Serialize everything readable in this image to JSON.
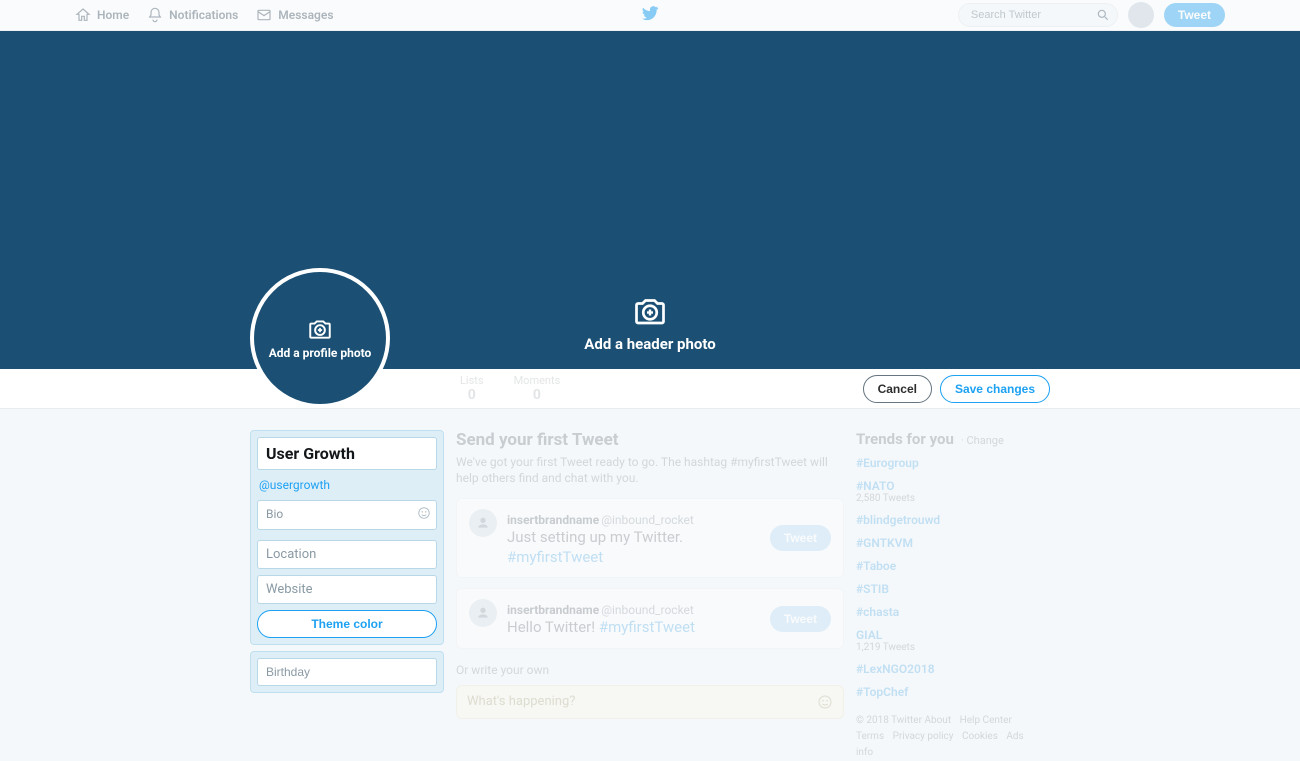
{
  "nav": {
    "home": "Home",
    "notifications": "Notifications",
    "messages": "Messages",
    "searchPlaceholder": "Search Twitter",
    "tweet": "Tweet"
  },
  "header": {
    "addHeader": "Add a header photo",
    "addProfile": "Add a profile photo"
  },
  "stats": {
    "listsLabel": "Lists",
    "listsVal": "0",
    "momentsLabel": "Moments",
    "momentsVal": "0"
  },
  "buttons": {
    "cancel": "Cancel",
    "save": "Save changes",
    "theme": "Theme color"
  },
  "edit": {
    "name": "User Growth",
    "handle": "@usergrowth",
    "bioPlaceholder": "Bio",
    "locationPlaceholder": "Location",
    "websitePlaceholder": "Website",
    "birthdayPlaceholder": "Birthday"
  },
  "first": {
    "title": "Send your first Tweet",
    "sub": "We've got your first Tweet ready to go. The hashtag #myfirstTweet will help others find and chat with you."
  },
  "tweets": [
    {
      "name": "insertbrandname",
      "handle": "@inbound_rocket",
      "textA": "Just setting up my Twitter. ",
      "hashtag": "#myfirstTweet",
      "btn": "Tweet"
    },
    {
      "name": "insertbrandname",
      "handle": "@inbound_rocket",
      "textA": "Hello Twitter! ",
      "hashtag": "#myfirstTweet",
      "btn": "Tweet"
    }
  ],
  "orWrite": "Or write your own",
  "composePlaceholder": "What's happening?",
  "trends": {
    "title": "Trends for you",
    "change": "· Change",
    "items": [
      {
        "tag": "#Eurogroup",
        "sub": ""
      },
      {
        "tag": "#NATO",
        "sub": "2,580 Tweets"
      },
      {
        "tag": "#blindgetrouwd",
        "sub": ""
      },
      {
        "tag": "#GNTKVM",
        "sub": ""
      },
      {
        "tag": "#Taboe",
        "sub": ""
      },
      {
        "tag": "#STIB",
        "sub": ""
      },
      {
        "tag": "#chasta",
        "sub": ""
      },
      {
        "tag": "GIAL",
        "sub": "1,219 Tweets"
      },
      {
        "tag": "#LexNGO2018",
        "sub": ""
      },
      {
        "tag": "#TopChef",
        "sub": ""
      }
    ]
  },
  "footer": {
    "copy": "© 2018 Twitter",
    "links": [
      "About",
      "Help Center",
      "Terms",
      "Privacy policy",
      "Cookies",
      "Ads info"
    ]
  }
}
